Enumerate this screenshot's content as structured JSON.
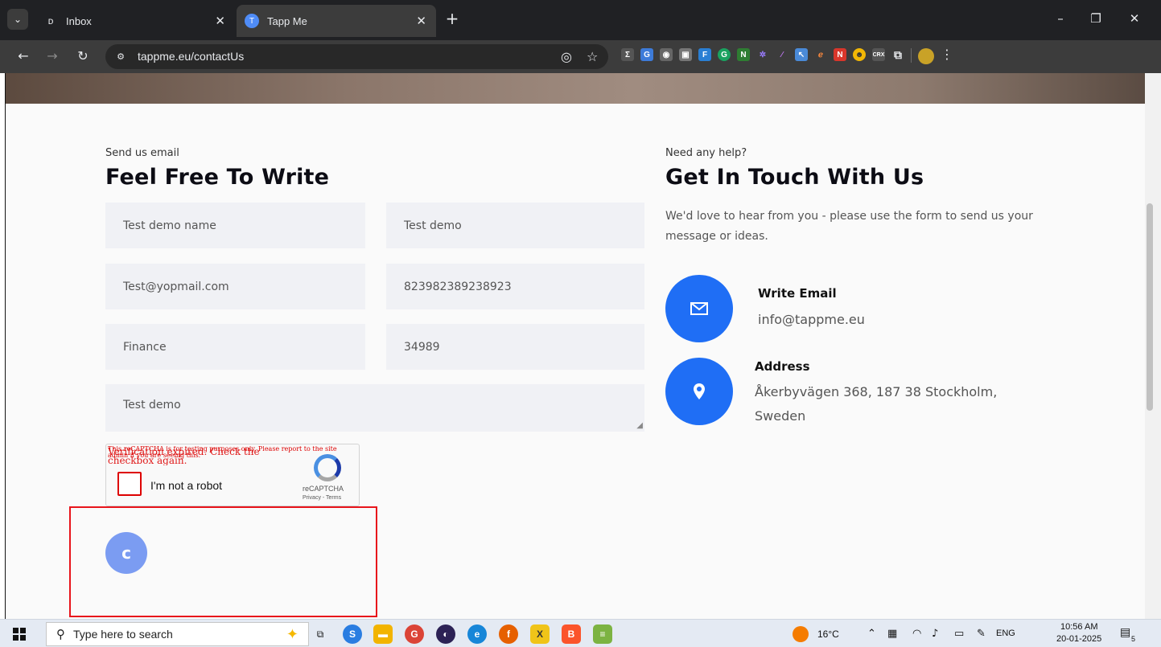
{
  "browser": {
    "tabs": [
      {
        "title": "Inbox",
        "active": false
      },
      {
        "title": "Tapp Me",
        "active": true
      }
    ],
    "tab_list_icon": "chevron-down-icon",
    "new_tab_label": "+",
    "url": "tappme.eu/contactUs",
    "window_controls": {
      "minimize": "–",
      "restore": "❐",
      "close": "✕"
    }
  },
  "form_section": {
    "eyebrow": "Send us email",
    "heading": "Feel Free To Write",
    "fields": {
      "name": "Test demo name",
      "last_name": "Test demo",
      "email": "Test@yopmail.com",
      "phone": "823982389238923",
      "subject": "Finance",
      "zip": "34989",
      "message": "Test demo"
    },
    "recaptcha": {
      "warning_text": "This reCAPTCHA is for testing purposes only. Please report to the site admin if you are seeing this.",
      "expired_text": "Verification expired. Check the checkbox again.",
      "checkbox_label": "I'm not a robot",
      "brand": "reCAPTCHA",
      "terms": "Privacy - Terms"
    },
    "submit_spinner_glyph": "c"
  },
  "contact_section": {
    "eyebrow": "Need any help?",
    "heading": "Get In Touch With Us",
    "lead": "We'd love to hear from you - please use the form to send us your message or ideas.",
    "email": {
      "title": "Write Email",
      "value": "info@tappme.eu"
    },
    "address": {
      "title": "Address",
      "value": "Åkerbyvägen 368, 187 38 Stockholm, Sweden"
    }
  },
  "taskbar": {
    "search_placeholder": "Type here to search",
    "weather": "16°C",
    "language": "ENG",
    "time": "10:56 AM",
    "date": "20-01-2025",
    "notification_count": "5"
  },
  "colors": {
    "accent_blue": "#1f6ef5",
    "spinner_blue": "#7b9cf2",
    "error_red": "#e8141b"
  }
}
